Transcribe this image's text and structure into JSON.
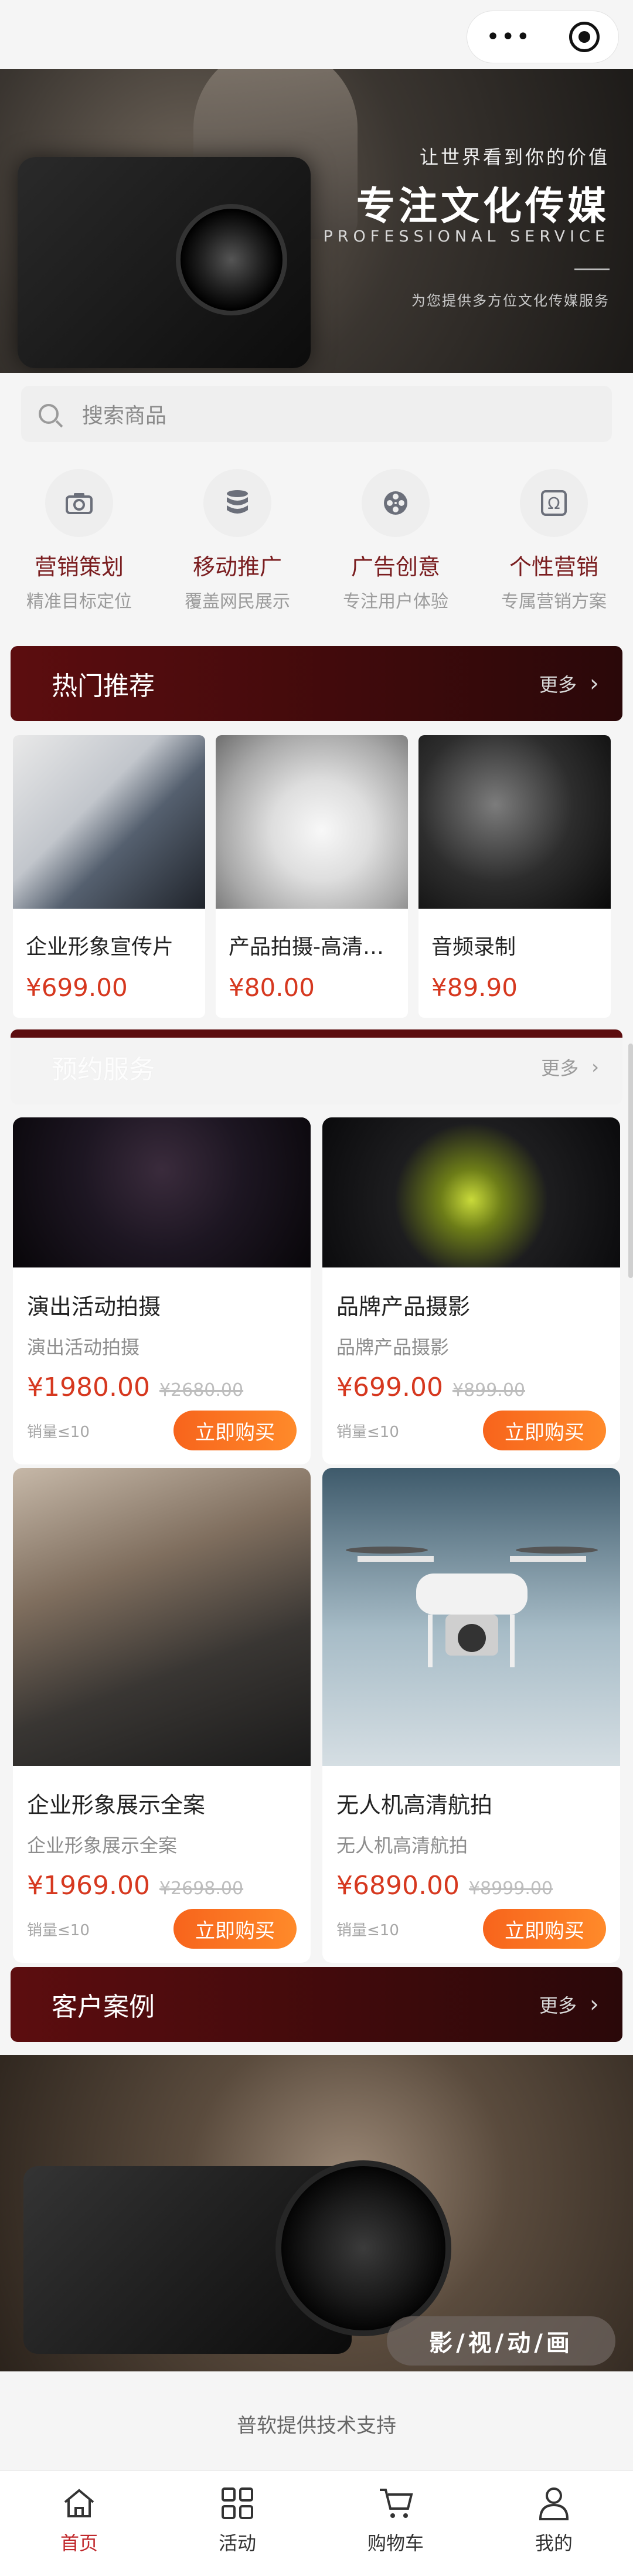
{
  "banner": {
    "tagline": "让世界看到你的价值",
    "headline": "专注文化传媒",
    "subtitle_en": "PROFESSIONAL SERVICE",
    "description": "为您提供多方位文化传媒服务"
  },
  "search": {
    "placeholder": "搜索商品"
  },
  "categories": [
    {
      "name": "营销策划",
      "sub": "精准目标定位",
      "icon": "camera-icon"
    },
    {
      "name": "移动推广",
      "sub": "覆盖网民展示",
      "icon": "database-icon"
    },
    {
      "name": "广告创意",
      "sub": "专注用户体验",
      "icon": "film-reel-icon"
    },
    {
      "name": "个性营销",
      "sub": "专属营销方案",
      "icon": "omega-icon"
    }
  ],
  "hot_section": {
    "title": "热门推荐",
    "more": "更多"
  },
  "hot_items": [
    {
      "name": "企业形象宣传片",
      "price": "¥699.00"
    },
    {
      "name": "产品拍摄-高清…",
      "price": "¥80.00"
    },
    {
      "name": "音频录制",
      "price": "¥89.90"
    }
  ],
  "booking_section": {
    "title": "预约服务",
    "more": "更多"
  },
  "booking_items": [
    {
      "name": "演出活动拍摄",
      "sub": "演出活动拍摄",
      "price": "¥1980.00",
      "old_price": "¥2680.00",
      "sales": "销量≤10",
      "buy": "立即购买"
    },
    {
      "name": "品牌产品摄影",
      "sub": "品牌产品摄影",
      "price": "¥699.00",
      "old_price": "¥899.00",
      "sales": "销量≤10",
      "buy": "立即购买"
    },
    {
      "name": "企业形象展示全案",
      "sub": "企业形象展示全案",
      "price": "¥1969.00",
      "old_price": "¥2698.00",
      "sales": "销量≤10",
      "buy": "立即购买"
    },
    {
      "name": "无人机高清航拍",
      "sub": "无人机高清航拍",
      "price": "¥6890.00",
      "old_price": "¥8999.00",
      "sales": "销量≤10",
      "buy": "立即购买"
    }
  ],
  "case_section": {
    "title": "客户案例",
    "more": "更多",
    "tag": "影/视/动/画"
  },
  "footer": {
    "support": "普软提供技术支持"
  },
  "tabbar": [
    {
      "label": "首页",
      "icon": "home-icon"
    },
    {
      "label": "活动",
      "icon": "grid-icon"
    },
    {
      "label": "购物车",
      "icon": "cart-icon"
    },
    {
      "label": "我的",
      "icon": "user-icon"
    }
  ],
  "colors": {
    "brand": "#5c0d0f",
    "price": "#d6381f",
    "buy_button": "#f7641c",
    "active_tab": "#c0282c"
  }
}
